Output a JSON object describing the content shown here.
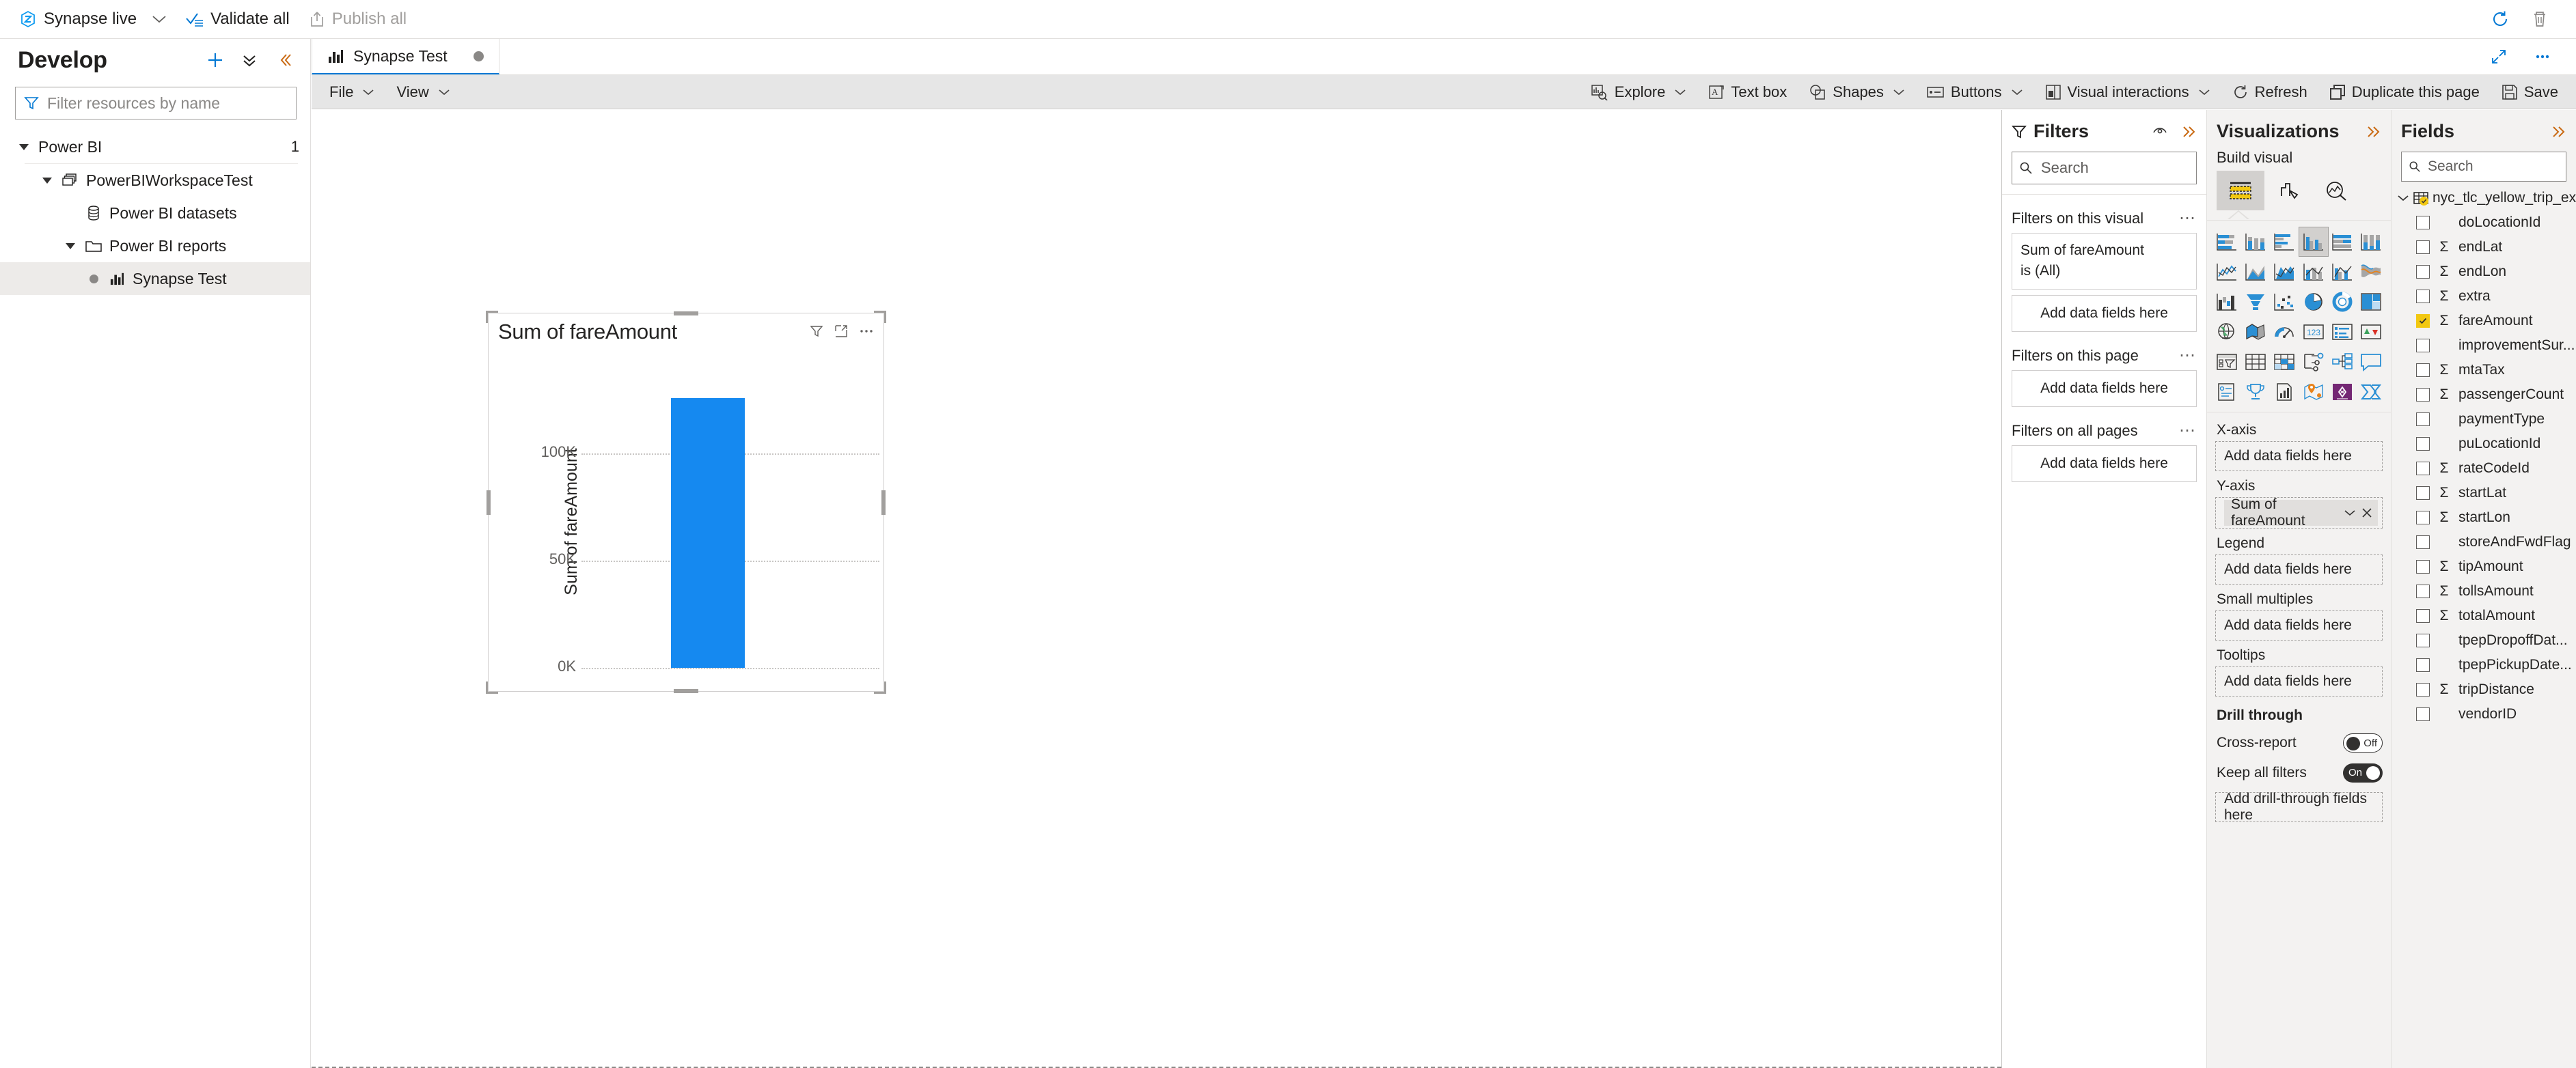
{
  "topbar": {
    "workspace": "Synapse live",
    "validate_all": "Validate all",
    "publish_all": "Publish all",
    "refresh_icon": "refresh-icon",
    "discard_icon": "discard-all-icon"
  },
  "left_panel": {
    "title": "Develop",
    "filter_placeholder": "Filter resources by name",
    "add_label": "+",
    "tree": [
      {
        "label": "Power BI",
        "count": "1",
        "level": 0,
        "expanded": true,
        "icon": "none",
        "selected": false
      },
      {
        "label": "PowerBIWorkspaceTest",
        "count": "",
        "level": 1,
        "expanded": true,
        "icon": "workspace-icon",
        "selected": false
      },
      {
        "label": "Power BI datasets",
        "count": "",
        "level": 2,
        "expanded": null,
        "icon": "dataset-icon",
        "selected": false
      },
      {
        "label": "Power BI reports",
        "count": "",
        "level": 2,
        "expanded": true,
        "icon": "folder-icon",
        "selected": false
      },
      {
        "label": "Synapse Test",
        "count": "",
        "level": 3,
        "expanded": null,
        "icon": "report-icon",
        "selected": true
      }
    ]
  },
  "tabstrip": {
    "tabs": [
      {
        "label": "Synapse Test",
        "icon": "report-icon",
        "modified": true
      }
    ],
    "expand_icon": "expand-icon",
    "more_icon": "more-icon"
  },
  "report_toolbar": {
    "left": [
      {
        "label": "File",
        "caret": true
      },
      {
        "label": "View",
        "caret": true
      }
    ],
    "right": [
      {
        "label": "Explore",
        "icon": "explore-icon",
        "caret": true
      },
      {
        "label": "Text box",
        "icon": "textbox-icon",
        "caret": false
      },
      {
        "label": "Shapes",
        "icon": "shapes-icon",
        "caret": true
      },
      {
        "label": "Buttons",
        "icon": "buttons-icon",
        "caret": true
      },
      {
        "label": "Visual interactions",
        "icon": "visual-interactions-icon",
        "caret": true
      },
      {
        "label": "Refresh",
        "icon": "refresh-icon",
        "caret": false
      },
      {
        "label": "Duplicate this page",
        "icon": "duplicate-icon",
        "caret": false
      },
      {
        "label": "Save",
        "icon": "save-icon",
        "caret": false
      }
    ]
  },
  "chart_data": {
    "type": "bar",
    "title": "Sum of fareAmount",
    "categories": [
      ""
    ],
    "values": [
      126000
    ],
    "series": [
      {
        "name": "Sum of fareAmount",
        "values": [
          126000
        ]
      }
    ],
    "xlabel": "",
    "ylabel": "Sum of fareAmount",
    "ylim": [
      0,
      145000
    ],
    "yticks": [
      0,
      50000,
      100000
    ],
    "ytick_labels": [
      "0K",
      "50K",
      "100K"
    ],
    "grid": true,
    "legend": "none",
    "bar_color": "#1589f0",
    "header_icons": [
      "filter-icon",
      "focus-mode-icon",
      "more-options-icon"
    ]
  },
  "filters_pane": {
    "title": "Filters",
    "eye_icon": "eye-icon",
    "collapse_icon": "collapse-icon",
    "search_placeholder": "Search",
    "sections": [
      {
        "title": "Filters on this visual",
        "cards": [
          {
            "line1": "Sum of fareAmount",
            "line2": "is (All)"
          }
        ],
        "drop_label": "Add data fields here"
      },
      {
        "title": "Filters on this page",
        "cards": [],
        "drop_label": "Add data fields here"
      },
      {
        "title": "Filters on all pages",
        "cards": [],
        "drop_label": "Add data fields here"
      }
    ]
  },
  "visualizations_pane": {
    "title": "Visualizations",
    "collapse_icon": "collapse-icon",
    "subtitle": "Build visual",
    "modes": [
      {
        "name": "build-visual-icon",
        "active": true
      },
      {
        "name": "format-visual-icon",
        "active": false
      },
      {
        "name": "analytics-icon",
        "active": false
      }
    ],
    "viz_icons": [
      "stacked-bar-chart",
      "stacked-column-chart",
      "clustered-bar-chart",
      "clustered-column-chart",
      "100-stacked-bar-chart",
      "100-stacked-column-chart",
      "line-chart",
      "area-chart",
      "stacked-area-chart",
      "line-and-stacked-column-chart",
      "line-and-clustered-column-chart",
      "ribbon-chart",
      "waterfall-chart",
      "funnel-chart",
      "scatter-chart",
      "pie-chart",
      "donut-chart",
      "treemap",
      "map",
      "filled-map",
      "gauge",
      "card",
      "multi-row-card",
      "kpi",
      "slicer",
      "table",
      "matrix",
      "decomposition-tree",
      "key-influencers",
      "qna",
      "paginated-report",
      "smart-narrative",
      "r-script-visual",
      "azure-map",
      "powerapps-visual",
      "power-automate-visual"
    ],
    "selected_viz_index": 3,
    "wells": [
      {
        "label": "X-axis",
        "bold": false,
        "type": "drop",
        "value": "Add data fields here"
      },
      {
        "label": "Y-axis",
        "bold": false,
        "type": "chip",
        "value": "Sum of fareAmount"
      },
      {
        "label": "Legend",
        "bold": false,
        "type": "drop",
        "value": "Add data fields here"
      },
      {
        "label": "Small multiples",
        "bold": false,
        "type": "drop",
        "value": "Add data fields here"
      },
      {
        "label": "Tooltips",
        "bold": false,
        "type": "drop",
        "value": "Add data fields here"
      }
    ],
    "drill_through": {
      "title": "Drill through",
      "cross_report": {
        "label": "Cross-report",
        "state": "Off"
      },
      "keep_all_filters": {
        "label": "Keep all filters",
        "state": "On"
      },
      "drop_label": "Add drill-through fields here"
    }
  },
  "fields_pane": {
    "title": "Fields",
    "collapse_icon": "collapse-icon",
    "search_placeholder": "Search",
    "table": {
      "name": "nyc_tlc_yellow_trip_ext",
      "expanded": true,
      "checked": true
    },
    "fields": [
      {
        "name": "doLocationId",
        "numeric": false,
        "checked": false
      },
      {
        "name": "endLat",
        "numeric": true,
        "checked": false
      },
      {
        "name": "endLon",
        "numeric": true,
        "checked": false
      },
      {
        "name": "extra",
        "numeric": true,
        "checked": false
      },
      {
        "name": "fareAmount",
        "numeric": true,
        "checked": true
      },
      {
        "name": "improvementSur...",
        "numeric": false,
        "checked": false
      },
      {
        "name": "mtaTax",
        "numeric": true,
        "checked": false
      },
      {
        "name": "passengerCount",
        "numeric": true,
        "checked": false
      },
      {
        "name": "paymentType",
        "numeric": false,
        "checked": false
      },
      {
        "name": "puLocationId",
        "numeric": false,
        "checked": false
      },
      {
        "name": "rateCodeId",
        "numeric": true,
        "checked": false
      },
      {
        "name": "startLat",
        "numeric": true,
        "checked": false
      },
      {
        "name": "startLon",
        "numeric": true,
        "checked": false
      },
      {
        "name": "storeAndFwdFlag",
        "numeric": false,
        "checked": false
      },
      {
        "name": "tipAmount",
        "numeric": true,
        "checked": false
      },
      {
        "name": "tollsAmount",
        "numeric": true,
        "checked": false
      },
      {
        "name": "totalAmount",
        "numeric": true,
        "checked": false
      },
      {
        "name": "tpepDropoffDat...",
        "numeric": false,
        "checked": false
      },
      {
        "name": "tpepPickupDate...",
        "numeric": false,
        "checked": false
      },
      {
        "name": "tripDistance",
        "numeric": true,
        "checked": false
      },
      {
        "name": "vendorID",
        "numeric": false,
        "checked": false
      }
    ]
  }
}
